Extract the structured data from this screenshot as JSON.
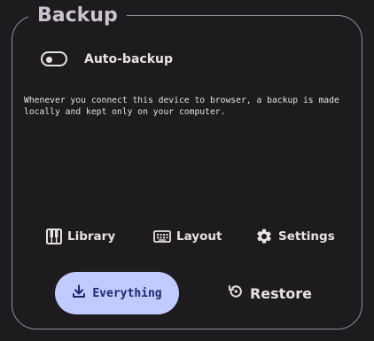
{
  "section": {
    "title": "Backup"
  },
  "auto_backup": {
    "label": "Auto-backup",
    "enabled": false
  },
  "description": "Whenever you connect this device to browser, a backup is made locally and kept only on your computer.",
  "nav": [
    {
      "label": "Library",
      "icon": "piano-keys-icon"
    },
    {
      "label": "Layout",
      "icon": "keyboard-icon"
    },
    {
      "label": "Settings",
      "icon": "gear-icon"
    }
  ],
  "actions": {
    "everything": {
      "label": "Everything",
      "icon": "download-icon"
    },
    "restore": {
      "label": "Restore",
      "icon": "restore-icon"
    }
  },
  "colors": {
    "background": "#1d1b1e",
    "outline": "#938f99",
    "primary_container": "#c2cbff",
    "on_primary_container": "#1b2a6e",
    "text": "#e6e1e5"
  }
}
